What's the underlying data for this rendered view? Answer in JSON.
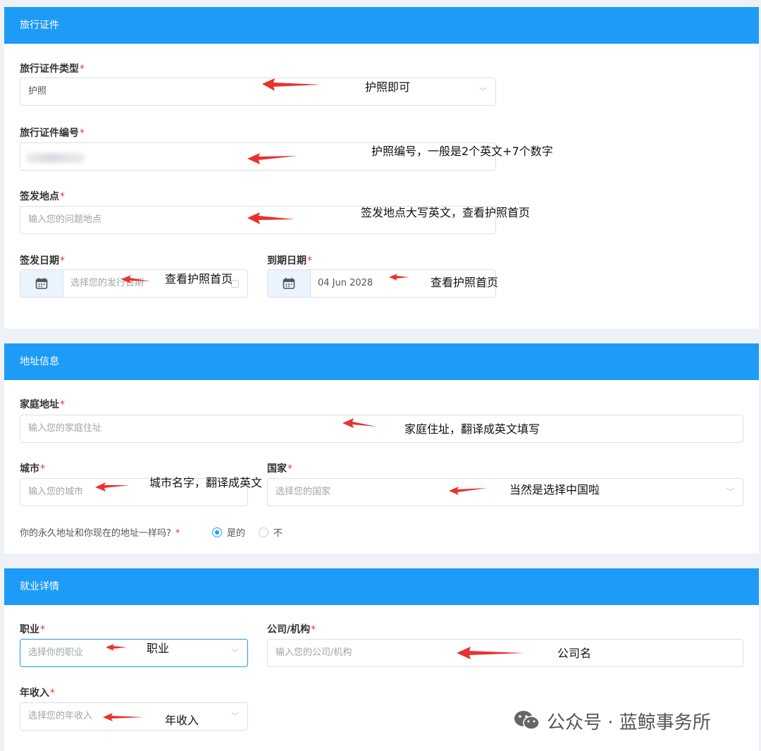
{
  "travel": {
    "header": "旅行证件",
    "doc_type": {
      "label": "旅行证件类型",
      "value": "护照",
      "note": "护照即可"
    },
    "doc_number": {
      "label": "旅行证件编号",
      "note": "护照编号，一般是2个英文+7个数字"
    },
    "issue_place": {
      "label": "签发地点",
      "placeholder": "输入您的问题地点",
      "note": "签发地点大写英文，查看护照首页"
    },
    "issue_date": {
      "label": "签发日期",
      "placeholder": "选择您的发行日期",
      "note": "查看护照首页"
    },
    "expiry_date": {
      "label": "到期日期",
      "value": "04 Jun 2028",
      "note": "查看护照首页"
    }
  },
  "address": {
    "header": "地址信息",
    "home": {
      "label": "家庭地址",
      "placeholder": "输入您的家庭住址",
      "note": "家庭住址，翻译成英文填写"
    },
    "city": {
      "label": "城市",
      "placeholder": "输入您的城市",
      "note": "城市名字，翻译成英文"
    },
    "country": {
      "label": "国家",
      "placeholder": "选择您的国家",
      "note": "当然是选择中国啦"
    },
    "permanent": {
      "question": "你的永久地址和你现在的地址一样吗?",
      "yes": "是的",
      "no": "不",
      "selected": "yes"
    }
  },
  "employment": {
    "header": "就业详情",
    "occupation": {
      "label": "职业",
      "placeholder": "选择你的职业",
      "note": "职业"
    },
    "company": {
      "label": "公司/机构",
      "placeholder": "输入您的公司/机构",
      "note": "公司名"
    },
    "income": {
      "label": "年收入",
      "placeholder": "选择您的年收入",
      "note": "年收入"
    }
  },
  "required_mark": "*",
  "watermark": "公众号 · 蓝鲸事务所",
  "colors": {
    "accent": "#1e9bf7",
    "required": "#e53935",
    "arrow": "#e8322e"
  },
  "icons": {
    "calendar": "calendar-icon",
    "chevron": "chevron-down-icon",
    "wechat": "wechat-icon"
  }
}
